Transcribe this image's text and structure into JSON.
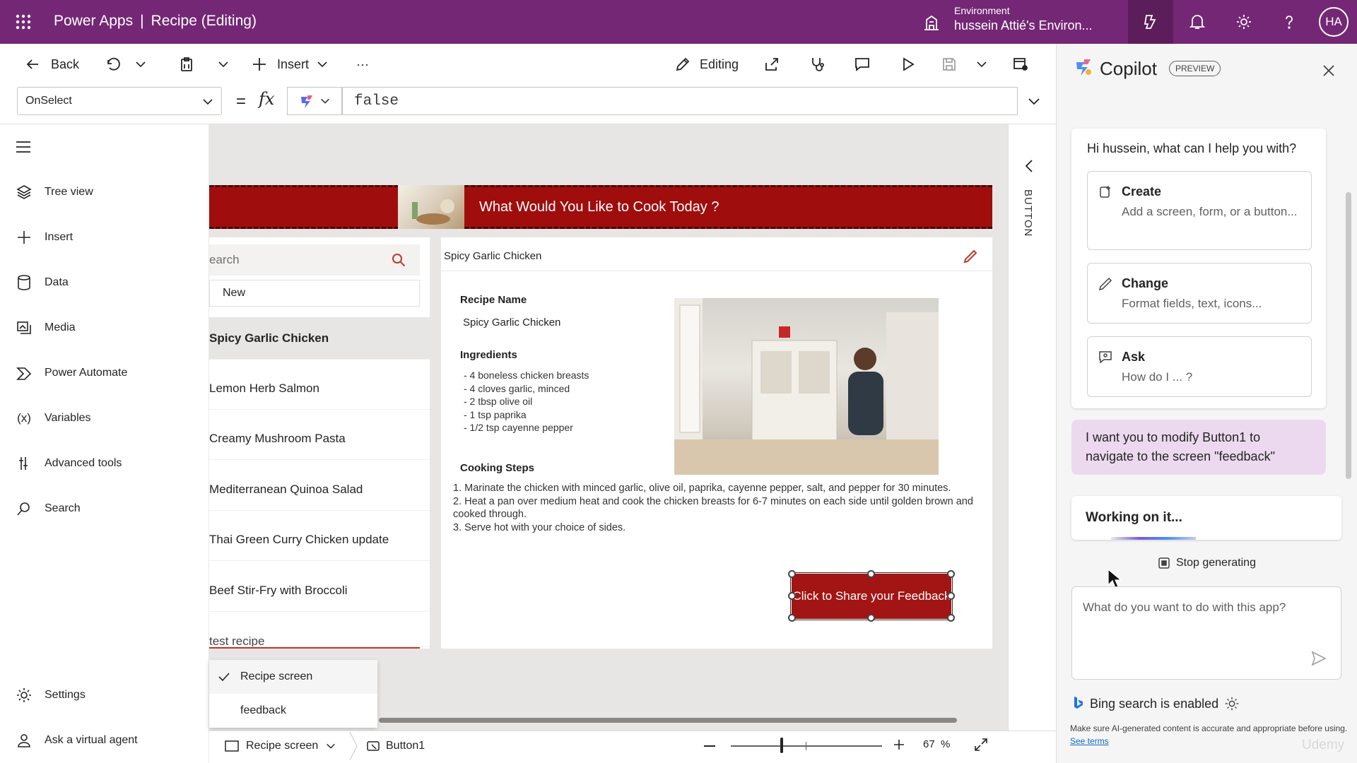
{
  "topbar": {
    "app_name": "Power Apps",
    "separator": "|",
    "doc_title": "Recipe (Editing)",
    "environment_label": "Environment",
    "environment_name": "hussein Attié's Environ...",
    "avatar_initials": "HA",
    "bg_color": "#742774"
  },
  "commandbar": {
    "back": "Back",
    "insert": "Insert",
    "more": "···",
    "editing": "Editing"
  },
  "formula_bar": {
    "property": "OnSelect",
    "equals": "=",
    "fx": "fx",
    "formula": "false"
  },
  "left_nav": {
    "items": [
      {
        "label": "Tree view",
        "icon": "layers-icon"
      },
      {
        "label": "Insert",
        "icon": "plus-icon"
      },
      {
        "label": "Data",
        "icon": "database-icon"
      },
      {
        "label": "Media",
        "icon": "media-icon"
      },
      {
        "label": "Power Automate",
        "icon": "power-automate-icon"
      },
      {
        "label": "Variables",
        "icon": "variables-icon"
      },
      {
        "label": "Advanced tools",
        "icon": "tools-icon"
      },
      {
        "label": "Search",
        "icon": "search-icon"
      }
    ],
    "settings": "Settings",
    "virtual_agent": "Ask a virtual agent"
  },
  "app": {
    "banner_title": "What Would You Like to Cook Today ?",
    "search_placeholder": "earch",
    "new_button": "New",
    "gallery": [
      "Spicy Garlic Chicken",
      "Lemon Herb Salmon",
      "Creamy Mushroom Pasta",
      "Mediterranean Quinoa Salad",
      "Thai Green Curry Chicken update",
      "Beef Stir-Fry with Broccoli",
      "test recipe"
    ],
    "selected_title": "Spicy Garlic Chicken",
    "recipe_name_label": "Recipe Name",
    "recipe_name": "Spicy Garlic Chicken",
    "ingredients_label": "Ingredients",
    "ingredients": [
      "- 4 boneless chicken breasts",
      "- 4 cloves garlic, minced",
      "- 2 tbsp olive oil",
      "- 1 tsp paprika",
      "- 1/2 tsp cayenne pepper"
    ],
    "steps_label": "Cooking Steps",
    "steps": [
      "1. Marinate the chicken with minced garlic, olive oil, paprika, cayenne pepper, salt, and pepper for 30 minutes.",
      "2. Heat a pan over medium heat and cook the chicken breasts for 6-7 minutes on each side until golden brown and cooked through.",
      "3. Serve hot with your choice of sides."
    ],
    "feedback_button": "Click to Share your Feedback",
    "accent_color": "#a31515"
  },
  "right_strip": {
    "label": "BUTTON"
  },
  "screens_menu": {
    "items": [
      "Recipe screen",
      "feedback"
    ]
  },
  "bottom_bar": {
    "screen": "Recipe screen",
    "control": "Button1",
    "zoom": "67",
    "zoom_unit": "%"
  },
  "copilot": {
    "title": "Copilot",
    "badge": "PREVIEW",
    "greeting": "Hi hussein, what can I help you with?",
    "options": [
      {
        "title": "Create",
        "desc": "Add a screen, form, or a button..."
      },
      {
        "title": "Change",
        "desc": "Format fields, text, icons..."
      },
      {
        "title": "Ask",
        "desc": "How do I ... ?"
      }
    ],
    "user_message": "I want you to modify Button1 to navigate to the screen \"feedback\"",
    "status": "Working on it...",
    "stop": "Stop generating",
    "input_placeholder": "What do you want to do with this app?",
    "bing": "Bing search is enabled",
    "disclaimer": "Make sure AI-generated content is accurate and appropriate before using.",
    "see_terms": "See terms"
  },
  "watermark": "Udemy"
}
